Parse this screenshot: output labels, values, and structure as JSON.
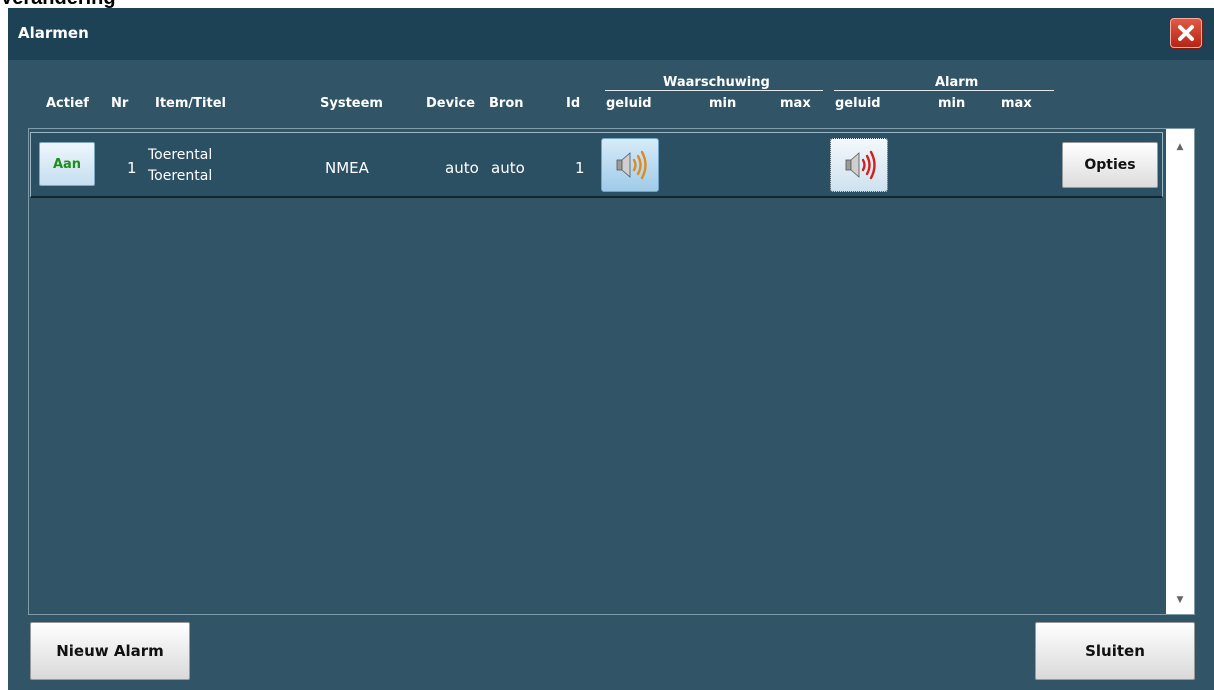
{
  "page_heading": "Verandering",
  "window": {
    "title": "Alarmen",
    "close_icon": "close-x-icon"
  },
  "columns": {
    "actief": "Actief",
    "nr": "Nr",
    "item": "Item/Titel",
    "systeem": "Systeem",
    "device": "Device",
    "bron": "Bron",
    "id": "Id",
    "warning_group": "Waarschuwing",
    "alarm_group": "Alarm",
    "geluid": "geluid",
    "min": "min",
    "max": "max"
  },
  "rows": [
    {
      "active_label": "Aan",
      "nr": "1",
      "item": "Toerental",
      "title": "Toerental",
      "systeem": "NMEA",
      "device": "auto",
      "bron": "auto",
      "id": "1",
      "warning_sound_icon": "speaker-orange-icon",
      "warning_min": "",
      "warning_max": "",
      "alarm_sound_icon": "speaker-red-icon",
      "alarm_min": "",
      "alarm_max": "",
      "options_label": "Opties"
    }
  ],
  "buttons": {
    "new_alarm": "Nieuw Alarm",
    "close": "Sluiten"
  },
  "colors": {
    "window_bg": "#315566",
    "titlebar_bg": "#1e4255",
    "active_text": "#1a8f1a",
    "warning_speaker": "#e08a1e",
    "alarm_speaker": "#d21f1f"
  }
}
